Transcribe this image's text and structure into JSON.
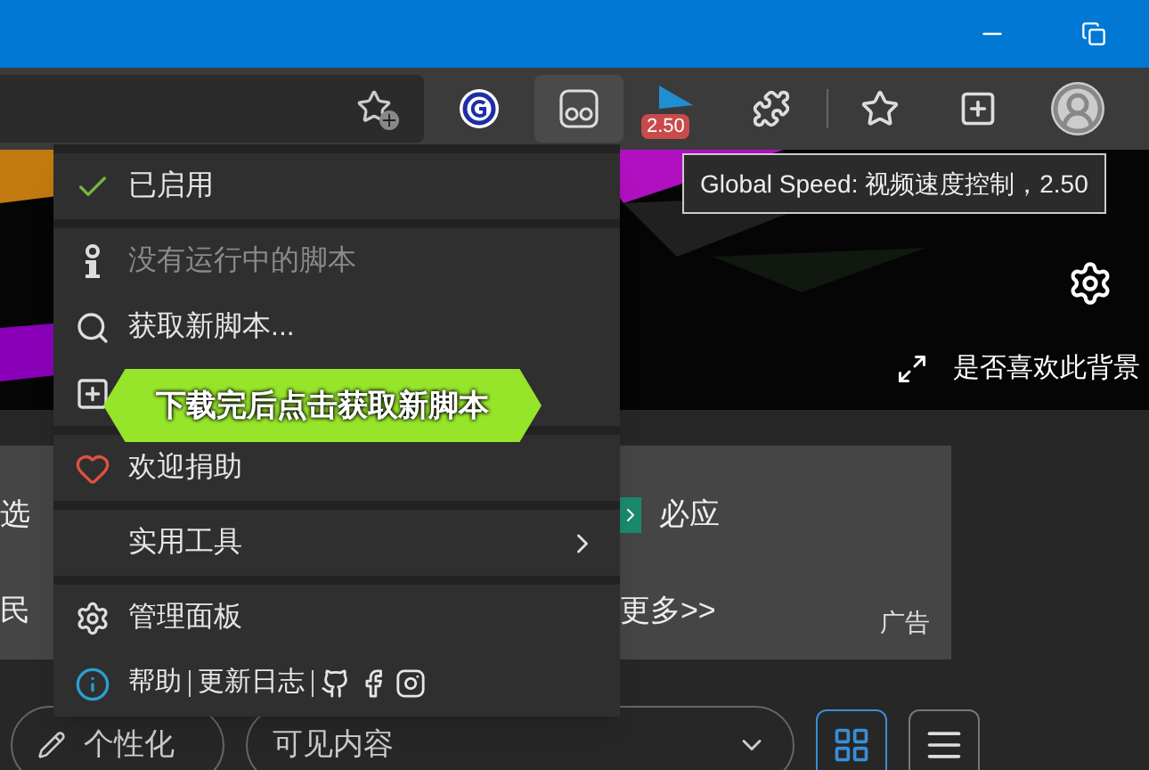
{
  "toolbar": {
    "extensions": [
      {
        "kind": "grammar",
        "selected": false
      },
      {
        "kind": "monkey",
        "selected": true
      },
      {
        "kind": "speed",
        "selected": false,
        "badge": "2.50"
      }
    ]
  },
  "tooltip": {
    "text": "Global Speed: 视频速度控制，2.50"
  },
  "background": {
    "caption": "是否喜欢此背景"
  },
  "ad": {
    "items": [
      {
        "kind": "text",
        "label": "选"
      },
      {
        "kind": "bing",
        "label": "必应"
      },
      {
        "kind": "text",
        "label": "民"
      },
      {
        "kind": "text",
        "label": "更多>>"
      }
    ],
    "label": "广告"
  },
  "bottom_bar": {
    "buttons": [
      {
        "kind": "pill",
        "label": "个性化"
      },
      {
        "kind": "dropdown",
        "label": "可见内容"
      }
    ],
    "view_modes": [
      {
        "kind": "grid",
        "selected": true
      },
      {
        "kind": "list",
        "selected": false
      }
    ]
  },
  "menu": {
    "sections": [
      [
        {
          "kind": "check",
          "label": "已启用",
          "disabled": false
        }
      ],
      [
        {
          "kind": "info",
          "label": "没有运行中的脚本",
          "disabled": true
        },
        {
          "kind": "search",
          "label": "获取新脚本...",
          "disabled": false
        },
        {
          "kind": "add",
          "disabled": false
        }
      ],
      [
        {
          "kind": "heart",
          "label": "欢迎捐助",
          "disabled": false
        }
      ],
      [
        {
          "kind": "submenu",
          "label": "实用工具",
          "disabled": false
        }
      ],
      [
        {
          "kind": "gear",
          "label": "管理面板",
          "disabled": false
        },
        {
          "kind": "help",
          "links": [
            "帮助",
            "更新日志"
          ],
          "disabled": false
        }
      ]
    ]
  },
  "callout": {
    "text": "下载完后点击获取新脚本"
  }
}
